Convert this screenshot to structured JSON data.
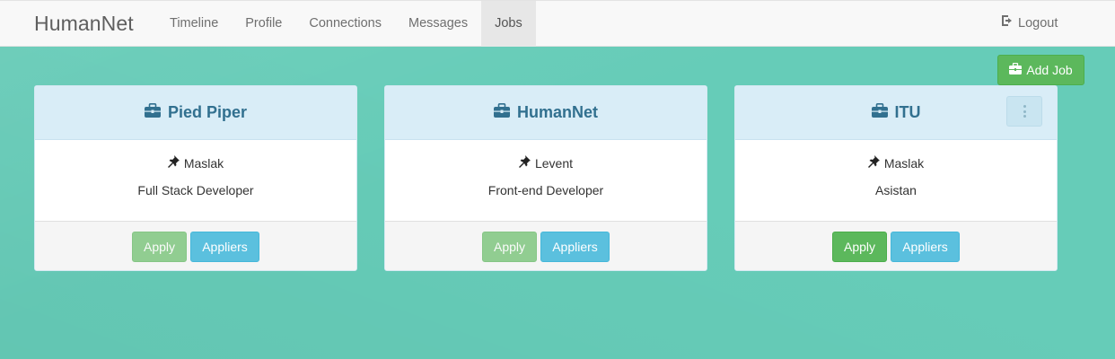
{
  "navbar": {
    "brand": "HumanNet",
    "items": [
      {
        "label": "Timeline",
        "active": false
      },
      {
        "label": "Profile",
        "active": false
      },
      {
        "label": "Connections",
        "active": false
      },
      {
        "label": "Messages",
        "active": false
      },
      {
        "label": "Jobs",
        "active": true
      }
    ],
    "logout_label": "Logout",
    "logout_icon": "logout-icon"
  },
  "toolbar": {
    "add_job_label": "Add Job",
    "add_job_icon": "briefcase-icon"
  },
  "jobs": [
    {
      "company": "Pied Piper",
      "location": "Maslak",
      "position": "Full Stack Developer",
      "apply_label": "Apply",
      "apply_enabled": false,
      "appliers_label": "Appliers",
      "has_menu": false
    },
    {
      "company": "HumanNet",
      "location": "Levent",
      "position": "Front-end Developer",
      "apply_label": "Apply",
      "apply_enabled": false,
      "appliers_label": "Appliers",
      "has_menu": false
    },
    {
      "company": "ITU",
      "location": "Maslak",
      "position": "Asistan",
      "apply_label": "Apply",
      "apply_enabled": true,
      "appliers_label": "Appliers",
      "has_menu": true
    }
  ],
  "colors": {
    "background": "#66ccb8",
    "panel_heading": "#d9edf7",
    "panel_title": "#31708f",
    "success": "#5cb85c",
    "info": "#5bc0de"
  }
}
